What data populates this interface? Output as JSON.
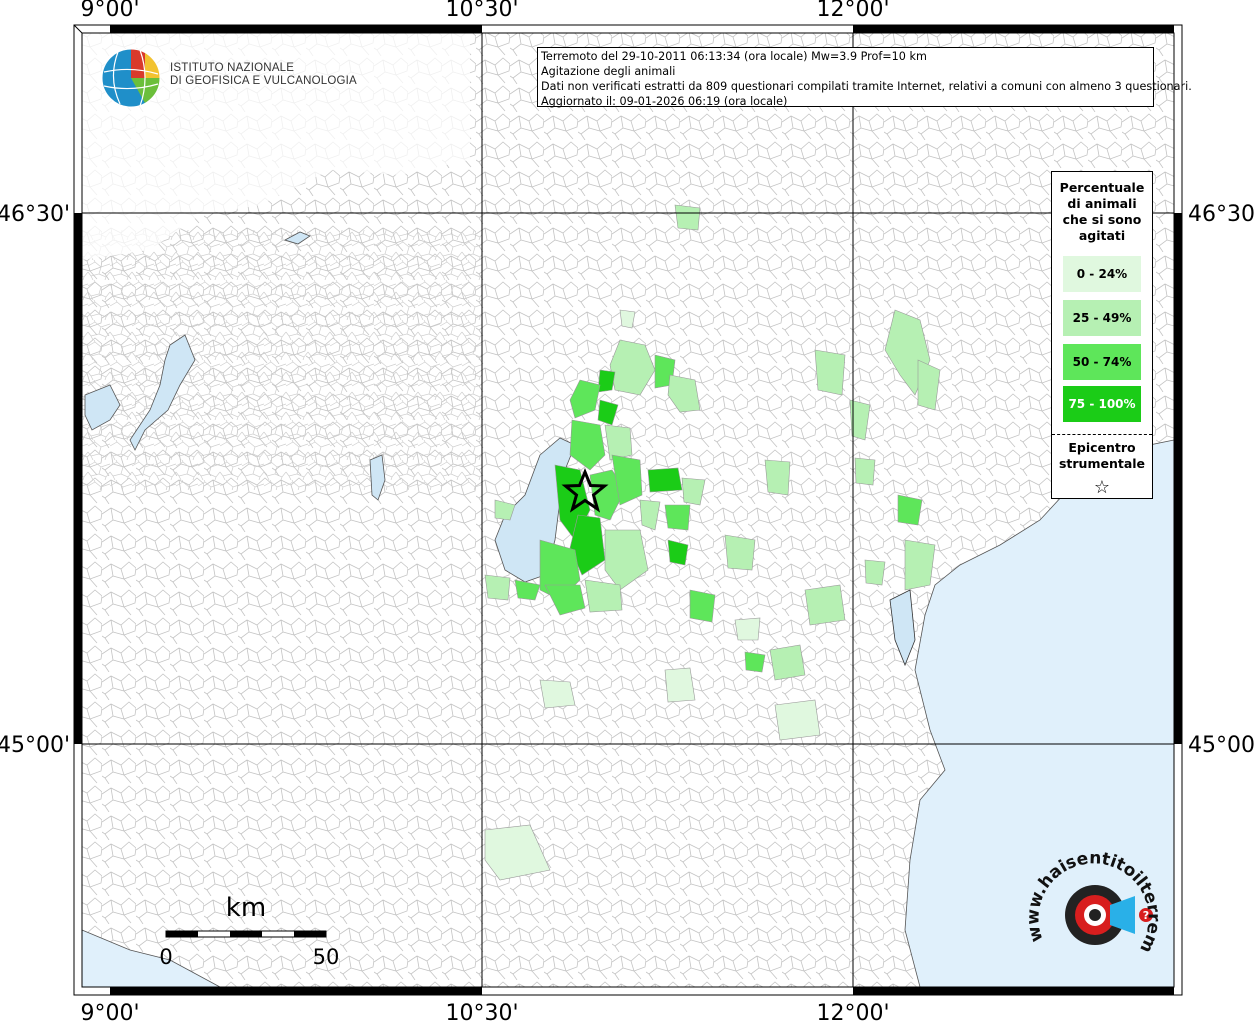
{
  "header": {
    "line1": "Terremoto del 29-10-2011 06:13:34 (ora locale) Mw=3.9 Prof=10 km",
    "line2": "Agitazione degli animali",
    "line3": "Dati non verificati estratti da 809 questionari compilati tramite Internet, relativi a comuni con almeno 3 questionari.",
    "line4": "Aggiornato il: 09-01-2026 06:19 (ora locale)"
  },
  "logo": {
    "line1": "ISTITUTO NAZIONALE",
    "line2": "DI GEOFISICA E VULCANOLOGIA"
  },
  "axes": {
    "lon_ticks": [
      "9°00'",
      "10°30'",
      "12°00'"
    ],
    "lat_ticks": [
      "46°30'",
      "45°00'"
    ]
  },
  "legend": {
    "title_lines": [
      "Percentuale",
      "di animali",
      "che si sono",
      "agitati"
    ],
    "classes": [
      {
        "label": "0 - 24%",
        "color": "#e0f8df"
      },
      {
        "label": "25 - 49%",
        "color": "#b6f0b3"
      },
      {
        "label": "50 - 74%",
        "color": "#5ee65a"
      },
      {
        "label": "75 - 100%",
        "color": "#1bcc17"
      }
    ],
    "epicenter_lines": [
      "Epicentro",
      "strumentale"
    ],
    "epicenter_symbol": "☆"
  },
  "scale_bar": {
    "unit": "km",
    "min": "0",
    "max": "50"
  },
  "watermark": {
    "text": "www.haisentitoilterremoto.it",
    "symbol": "?"
  },
  "colors": {
    "sea": "#e0f0fb",
    "boundary": "#bbbbbb",
    "grid": "#000000"
  }
}
